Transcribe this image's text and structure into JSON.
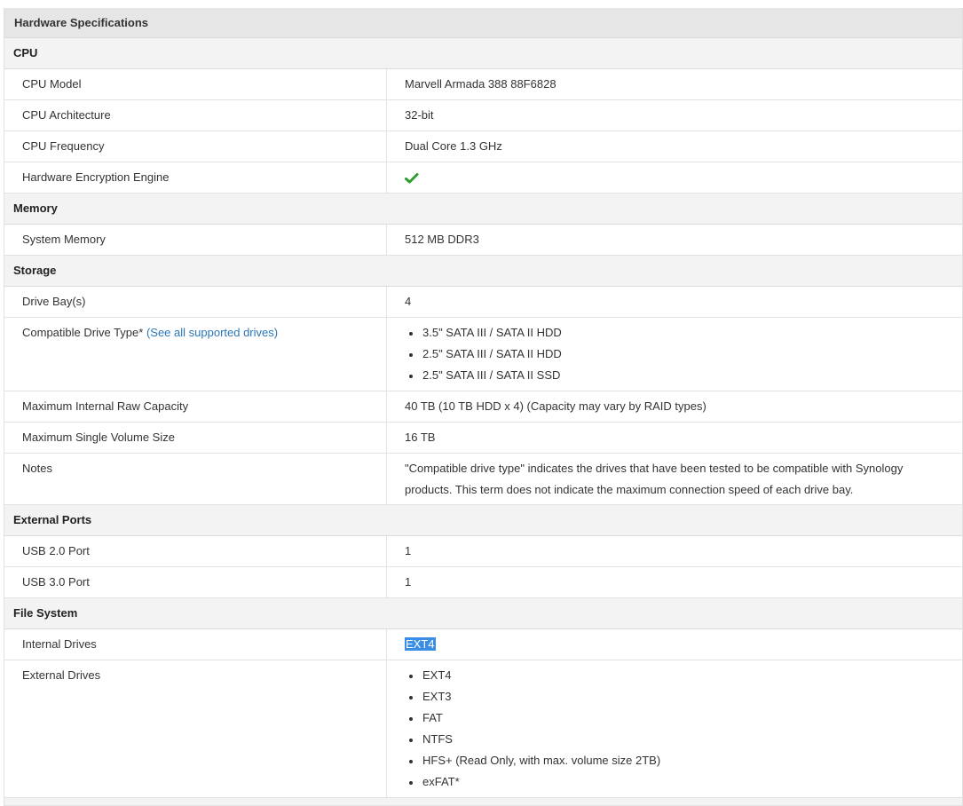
{
  "title": "Hardware Specifications",
  "colors": {
    "check": "#2e9c2e",
    "link": "#2a77b7",
    "selection": "#3a8ee6"
  },
  "sections": {
    "cpu": {
      "heading": "CPU",
      "cpu_model": {
        "label": "CPU Model",
        "value": "Marvell Armada 388 88F6828"
      },
      "cpu_architecture": {
        "label": "CPU Architecture",
        "value": "32-bit"
      },
      "cpu_frequency": {
        "label": "CPU Frequency",
        "value": "Dual Core 1.3 GHz"
      },
      "encryption": {
        "label": "Hardware Encryption Engine",
        "icon": "checkmark-icon"
      }
    },
    "memory": {
      "heading": "Memory",
      "system_memory": {
        "label": "System Memory",
        "value": "512 MB DDR3"
      }
    },
    "storage": {
      "heading": "Storage",
      "drive_bays": {
        "label": "Drive Bay(s)",
        "value": "4"
      },
      "compatible": {
        "label": "Compatible Drive Type*",
        "link": "(See all supported drives)",
        "items": [
          "3.5\" SATA III / SATA II HDD",
          "2.5\" SATA III / SATA II HDD",
          "2.5\" SATA III / SATA II SSD"
        ]
      },
      "max_capacity": {
        "label": "Maximum Internal Raw Capacity",
        "value": "40 TB (10 TB HDD x 4) (Capacity may vary by RAID types)"
      },
      "max_volume": {
        "label": "Maximum Single Volume Size",
        "value": "16 TB"
      },
      "notes": {
        "label": "Notes",
        "value": "\"Compatible drive type\" indicates the drives that have been tested to be compatible with Synology products. This term does not indicate the maximum connection speed of each drive bay."
      }
    },
    "ports": {
      "heading": "External Ports",
      "usb2": {
        "label": "USB 2.0 Port",
        "value": "1"
      },
      "usb3": {
        "label": "USB 3.0 Port",
        "value": "1"
      }
    },
    "filesystem": {
      "heading": "File System",
      "internal": {
        "label": "Internal Drives",
        "value": "EXT4"
      },
      "external": {
        "label": "External Drives",
        "items": [
          "EXT4",
          "EXT3",
          "FAT",
          "NTFS",
          "HFS+ (Read Only, with max. volume size 2TB)",
          "exFAT*"
        ]
      }
    }
  }
}
